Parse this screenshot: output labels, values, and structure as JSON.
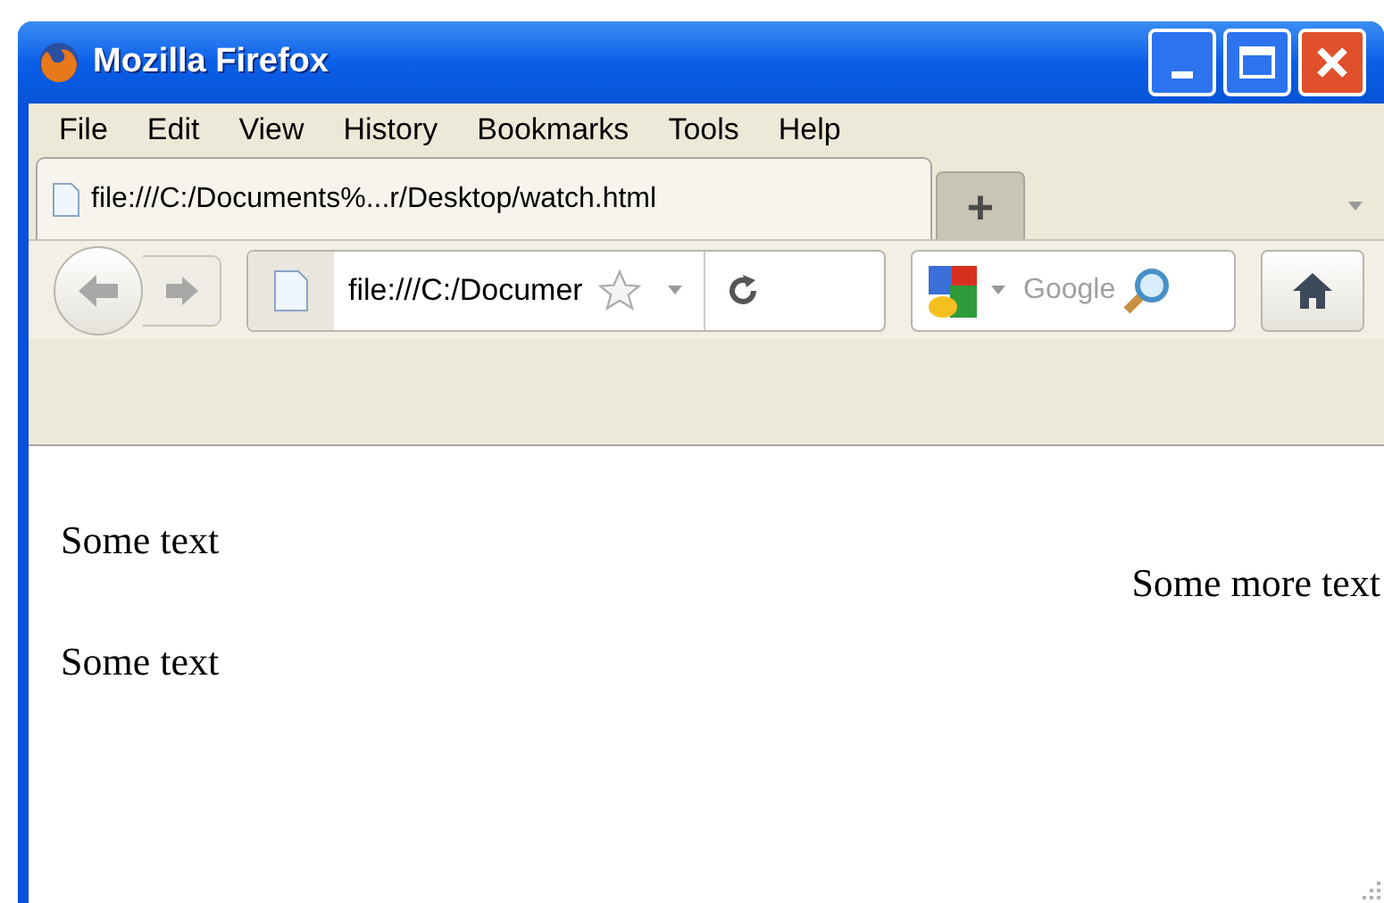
{
  "window": {
    "title": "Mozilla Firefox"
  },
  "menu": [
    "File",
    "Edit",
    "View",
    "History",
    "Bookmarks",
    "Tools",
    "Help"
  ],
  "tabs": [
    {
      "label": "file:///C:/Documents%...r/Desktop/watch.html",
      "selected": true
    }
  ],
  "new_tab": "+",
  "address_bar": {
    "value": "file:///C:/Documer"
  },
  "search": {
    "placeholder": "Google"
  },
  "content": {
    "paragraphs": [
      "Some text",
      "Some text"
    ],
    "right_text": "Some more text"
  }
}
